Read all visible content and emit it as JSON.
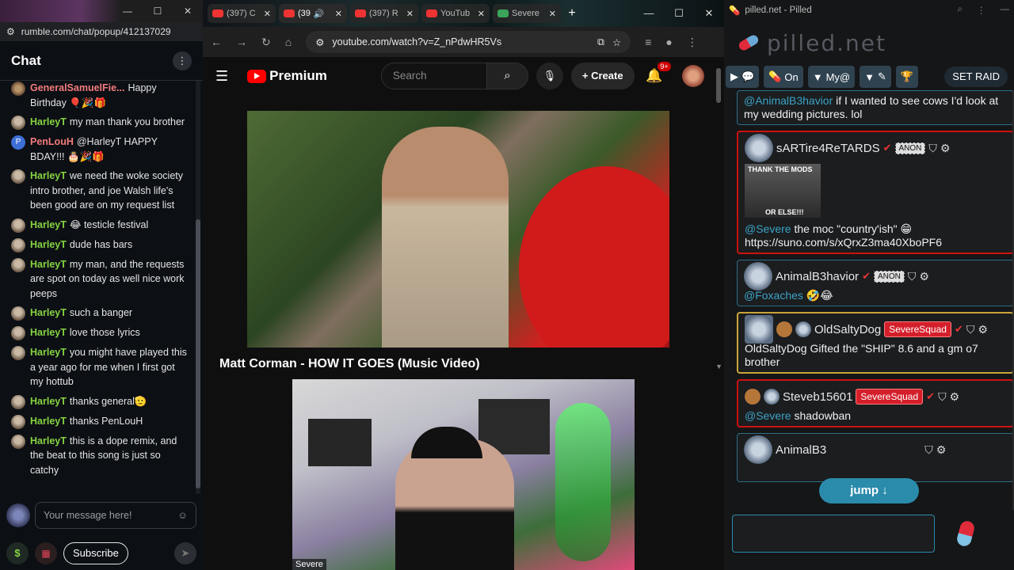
{
  "rumble": {
    "url": "rumble.com/chat/popup/412137029",
    "header_title": "Chat",
    "messages": [
      {
        "name": "GeneralSamuelFie...",
        "text": "Happy Birthday 🎈🎉🎁",
        "color": "pink"
      },
      {
        "name": "HarleyT",
        "text": "my man thank you brother"
      },
      {
        "name": "PenLouH",
        "text": "@HarleyT HAPPY BDAY!!! 🎂🎉🎁",
        "color": "p"
      },
      {
        "name": "HarleyT",
        "text": "we need the woke society intro brother, and joe Walsh life's been good are on my request list"
      },
      {
        "name": "HarleyT",
        "text": "😂 testicle festival"
      },
      {
        "name": "HarleyT",
        "text": "dude has bars"
      },
      {
        "name": "HarleyT",
        "text": "my man, and the requests are spot on today as well nice work peeps"
      },
      {
        "name": "HarleyT",
        "text": "such a banger"
      },
      {
        "name": "HarleyT",
        "text": "love those lyrics"
      },
      {
        "name": "HarleyT",
        "text": "you might have played this a year ago for me when I first got my hottub"
      },
      {
        "name": "HarleyT",
        "text": "thanks general🫡"
      },
      {
        "name": "HarleyT",
        "text": "thanks PenLouH"
      },
      {
        "name": "HarleyT",
        "text": "this is a dope remix, and the beat to this song is just so catchy"
      }
    ],
    "input_placeholder": "Your message here!",
    "subscribe_label": "Subscribe"
  },
  "youtube": {
    "tabs": [
      "(397) C",
      "(39",
      "(397) R",
      "YouTub",
      "Severe"
    ],
    "url": "youtube.com/watch?v=Z_nPdwHR5Vs",
    "brand": "Premium",
    "search_placeholder": "Search",
    "create_label": "Create",
    "notif_badge": "9+",
    "video_title": "Matt Corman - HOW IT GOES (Music Video)",
    "cam_label": "Severe"
  },
  "pilled": {
    "window_title": "pilled.net - Pilled",
    "logo_text": "pilled.net",
    "toolbar": {
      "on_label": "On",
      "my_label": "My@",
      "raid_label": "SET RAID"
    },
    "cards": [
      {
        "style": "blue",
        "mention": "@AnimalB3havior",
        "text": "if I wanted to see cows I'd look at my wedding pictures. lol"
      },
      {
        "style": "red",
        "user": "sARTire4ReTARDS",
        "badge": "ANON",
        "meme_top": "THANK THE MODS",
        "meme_bottom": "OR ELSE!!!",
        "mention": "@Severe",
        "text": "the moc \"country'ish\" 😁 https://suno.com/s/xQrxZ3ma40XboPF6"
      },
      {
        "style": "blue",
        "user": "AnimalB3havior",
        "badge": "ANON",
        "mention": "@Foxaches",
        "text": "🤣😂"
      },
      {
        "style": "gold",
        "user": "OldSaltyDog",
        "squad": "SevereSquad",
        "text": "OldSaltyDog Gifted the \"SHIP\" 8.6 and a gm o7 brother"
      },
      {
        "style": "red",
        "user": "Steveb15601",
        "squad": "SevereSquad",
        "mention": "@Severe",
        "text": "shadowban"
      },
      {
        "style": "blue",
        "user": "AnimalB3"
      }
    ],
    "jump_label": "jump ↓"
  }
}
